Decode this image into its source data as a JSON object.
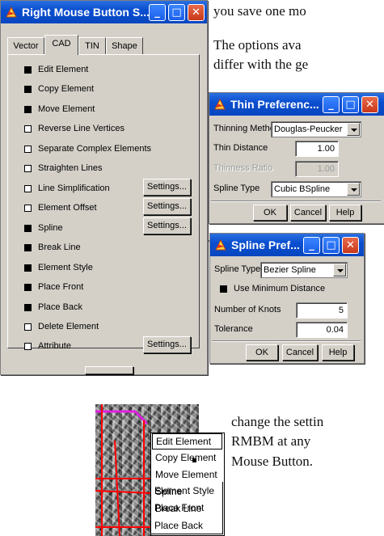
{
  "document": {
    "line1": "you save one mo",
    "line2": "The options ava",
    "line3": "differ with the ge",
    "line4": "change the settin",
    "line5": "RMBM at any",
    "line6": "Mouse Button."
  },
  "main_window": {
    "title": "Right Mouse Button S...",
    "tabs": [
      "Vector",
      "CAD",
      "TIN",
      "Shape"
    ],
    "active_tab": "CAD",
    "items": [
      {
        "label": "Edit Element",
        "checked": true
      },
      {
        "label": "Copy Element",
        "checked": true
      },
      {
        "label": "Move Element",
        "checked": true
      },
      {
        "label": "Reverse Line Vertices",
        "checked": false
      },
      {
        "label": "Separate Complex Elements",
        "checked": false
      },
      {
        "label": "Straighten Lines",
        "checked": false
      },
      {
        "label": "Line Simplification",
        "checked": false,
        "settings": "Settings..."
      },
      {
        "label": "Element Offset",
        "checked": false,
        "settings": "Settings..."
      },
      {
        "label": "Spline",
        "checked": true,
        "settings": "Settings..."
      },
      {
        "label": "Break Line",
        "checked": true
      },
      {
        "label": "Element Style",
        "checked": true
      },
      {
        "label": "Place Front",
        "checked": true
      },
      {
        "label": "Place Back",
        "checked": true
      },
      {
        "label": "Delete Element",
        "checked": false
      },
      {
        "label": "Attribute",
        "checked": false,
        "settings": "Settings..."
      }
    ]
  },
  "thin_window": {
    "title": "Thin Preferenc...",
    "method_label": "Thinning Method",
    "method_value": "Douglas-Peucker",
    "distance_label": "Thin Distance",
    "distance_value": "1.00",
    "ratio_label": "Thinness Ratio",
    "ratio_value": "1.00",
    "spline_label": "Spline Type",
    "spline_value": "Cubic BSpline",
    "ok": "OK",
    "cancel": "Cancel",
    "help": "Help"
  },
  "spline_window": {
    "title": "Spline Pref...",
    "type_label": "Spline Type",
    "type_value": "Bezier Spline",
    "min_distance_label": "Use Minimum Distance",
    "min_distance_checked": true,
    "knots_label": "Number of Knots",
    "knots_value": "5",
    "tolerance_label": "Tolerance",
    "tolerance_value": "0.04",
    "ok": "OK",
    "cancel": "Cancel",
    "help": "Help"
  },
  "context_menu": {
    "items": [
      "Edit Element",
      "Copy Element",
      "Move Element",
      "Spline",
      "Break Line",
      "Element Style",
      "Place Front",
      "Place Back"
    ]
  },
  "colors": {
    "titlebar": "#0a4fd0",
    "dialog": "#d4d0c8",
    "close_button": "#c9381a",
    "map_lines": "#ff0000",
    "map_highlight": "#e020e0"
  }
}
